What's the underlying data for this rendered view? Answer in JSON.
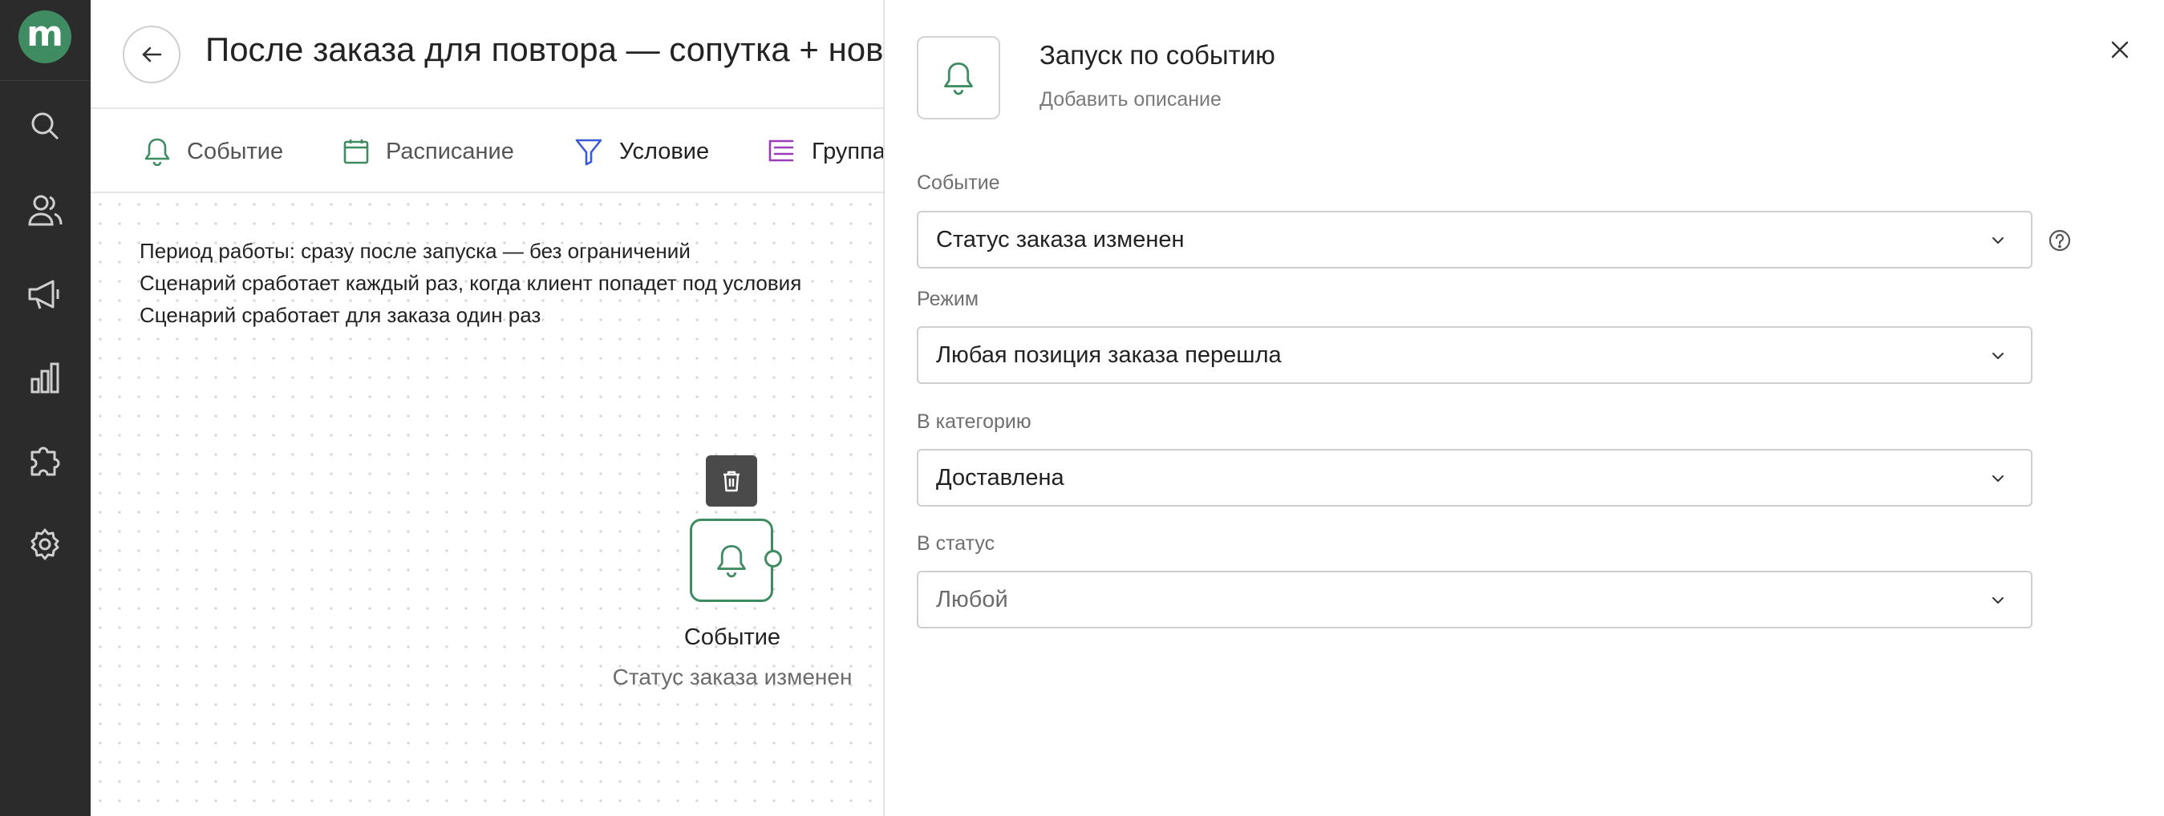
{
  "colors": {
    "accent": "#3f8b62",
    "rail": "#2b2b2b",
    "filter": "#3a5bd9",
    "group": "#9b3db8"
  },
  "rail": {
    "logo_letter": "m",
    "items": [
      {
        "icon": "search-icon"
      },
      {
        "icon": "users-icon"
      },
      {
        "icon": "megaphone-icon"
      },
      {
        "icon": "bar-chart-icon"
      },
      {
        "icon": "puzzle-icon"
      },
      {
        "icon": "gear-icon"
      }
    ]
  },
  "header": {
    "title": "После заказа для повтора — сопутка + новинки"
  },
  "toolbar": {
    "event": "Событие",
    "schedule": "Расписание",
    "condition": "Условие",
    "group": "Группа"
  },
  "canvas": {
    "info": [
      "Период работы: сразу после запуска — без ограничений",
      "Сценарий сработает каждый раз, когда клиент попадет под условия",
      "Сценарий сработает для заказа один раз"
    ],
    "node": {
      "title": "Событие",
      "subtitle": "Статус заказа изменен"
    }
  },
  "panel": {
    "title": "Запуск по событию",
    "description": "Добавить описание",
    "fields": {
      "event": {
        "label": "Событие",
        "value": "Статус заказа изменен"
      },
      "mode": {
        "label": "Режим",
        "value": "Любая позиция заказа перешла"
      },
      "category": {
        "label": "В категорию",
        "value": "Доставлена"
      },
      "status": {
        "label": "В статус",
        "value": "Любой"
      }
    }
  }
}
